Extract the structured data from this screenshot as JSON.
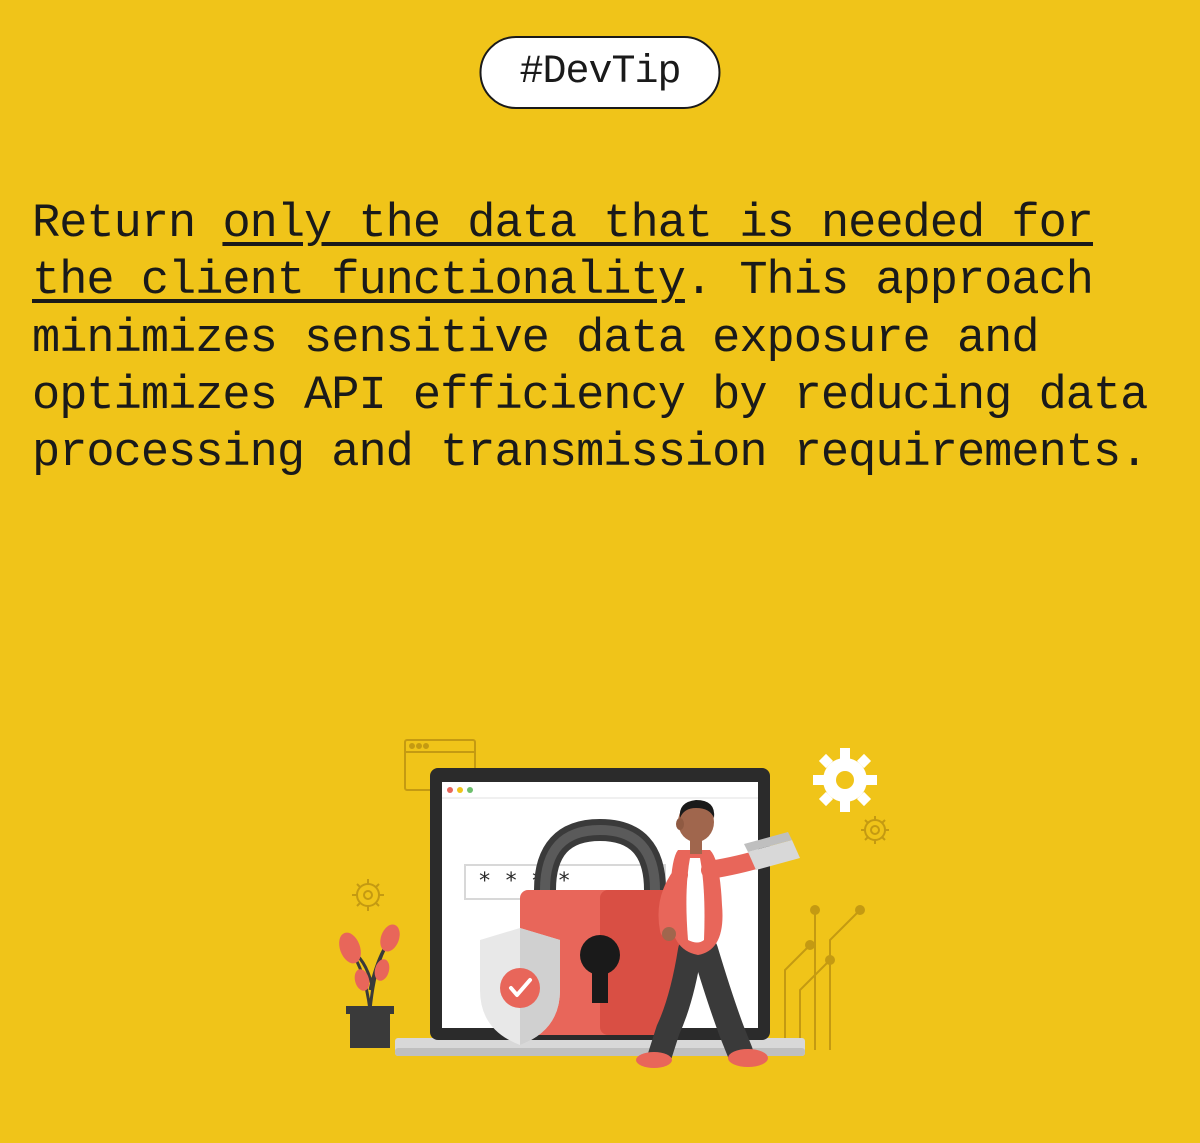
{
  "badge": {
    "label": "#DevTip"
  },
  "tip": {
    "prefix": "Return ",
    "underlined": "only the data that is needed for the client functionality",
    "suffix": ". This approach minimizes sensitive data exposure and optimizes API efficiency by reducing data processing and transmission requirements."
  },
  "colors": {
    "bg": "#f0c419",
    "badgeBg": "#ffffff",
    "text": "#1a1a1a",
    "lockBody": "#e8665a",
    "lockDark": "#d94f44",
    "laptopFrame": "#2b2b2b",
    "laptopBase": "#d8d8d8",
    "screenBg": "#ffffff",
    "personShirt": "#e8665a",
    "personPants": "#3a3a3a",
    "personSkin": "#a0664d",
    "shieldBg": "#e8e8e8",
    "shieldCheck": "#e8665a",
    "plantPot": "#3a3a3a",
    "plantLeaf": "#e8665a",
    "gearWhite": "#ffffff",
    "gearOutline": "#c49a12",
    "circuit": "#c49a12"
  }
}
